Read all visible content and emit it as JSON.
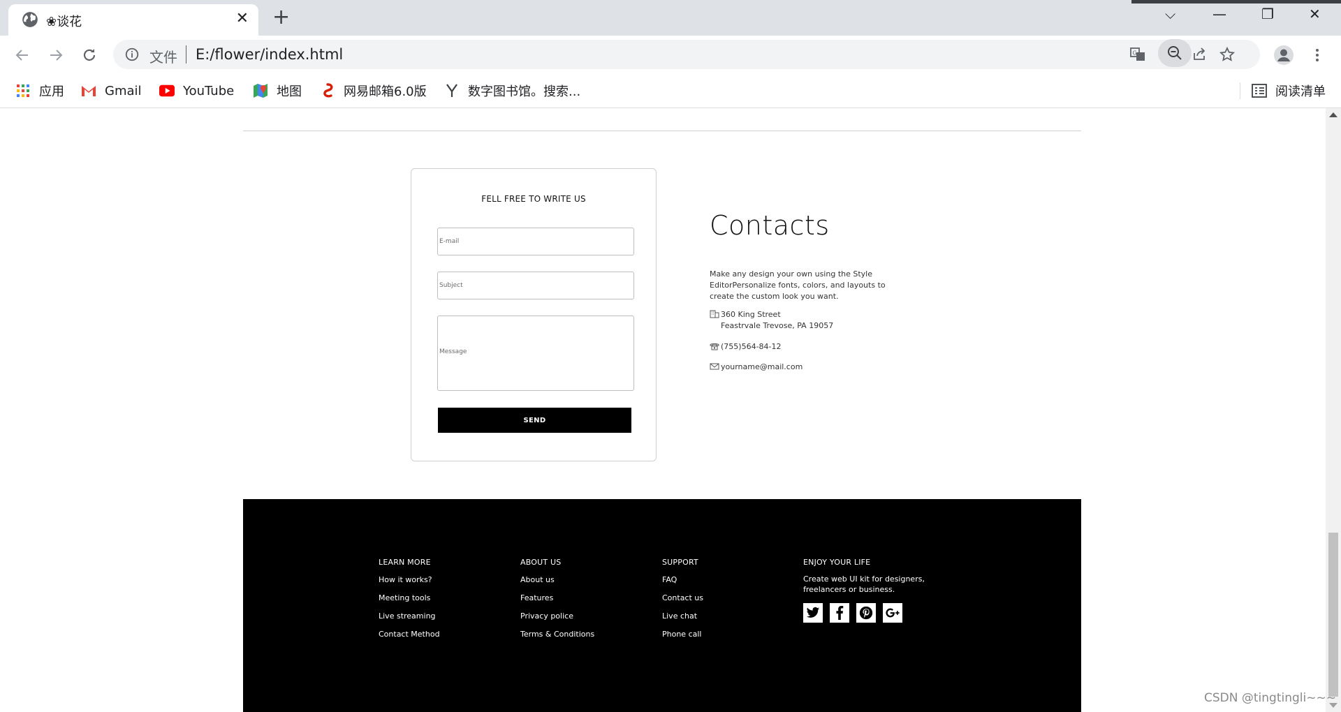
{
  "browser": {
    "tab_title": "❀谈花",
    "tab_close": "✕",
    "new_tab": "+",
    "window_controls": {
      "tabsearch": "⌵",
      "minimize": "—",
      "restore": "❐",
      "close": "✕"
    },
    "address": {
      "security_label": "文件",
      "url": "E:/flower/index.html"
    },
    "bookmarks": [
      {
        "label": "应用",
        "icon": "apps-grid-icon"
      },
      {
        "label": "Gmail",
        "icon": "gmail-icon"
      },
      {
        "label": "YouTube",
        "icon": "youtube-icon"
      },
      {
        "label": "地图",
        "icon": "maps-icon"
      },
      {
        "label": "网易邮箱6.0版",
        "icon": "netease-mail-icon"
      },
      {
        "label": "数字图书馆。搜索...",
        "icon": "library-icon"
      }
    ],
    "reading_list": "阅读清单"
  },
  "contact_form": {
    "title": "FELL FREE TO WRITE US",
    "email_placeholder": "E-mail",
    "subject_placeholder": "Subject",
    "message_placeholder": "Message",
    "send_label": "SEND"
  },
  "contacts": {
    "title": "Contacts",
    "description": "Make any design your own using the Style EditorPersonalize fonts, colors, and layouts to create the custom look you want.",
    "address_line1": "360 King Street",
    "address_line2": "Feastrvale Trevose, PA 19057",
    "phone": "(755)564-84-12",
    "email": "yourname@mail.com"
  },
  "footer": {
    "columns": [
      {
        "heading": "LEARN MORE",
        "links": [
          "How it works?",
          "Meeting tools",
          "Live streaming",
          "Contact Method"
        ]
      },
      {
        "heading": "ABOUT US",
        "links": [
          "About us",
          "Features",
          "Privacy police",
          "Terms & Conditions"
        ]
      },
      {
        "heading": "SUPPORT",
        "links": [
          "FAQ",
          "Contact us",
          "Live chat",
          "Phone call"
        ]
      }
    ],
    "enjoy": {
      "heading": "ENJOY YOUR LIFE",
      "text": "Create web UI kit for designers, freelancers or business."
    },
    "social": [
      "twitter-icon",
      "facebook-icon",
      "pinterest-icon",
      "google-plus-icon"
    ]
  },
  "watermark": "CSDN @tingtingli~~~",
  "colors": {
    "tab_strip": "#dee1e6",
    "footer_bg": "#000000",
    "button_bg": "#000000",
    "card_border": "#cfcfcf"
  }
}
